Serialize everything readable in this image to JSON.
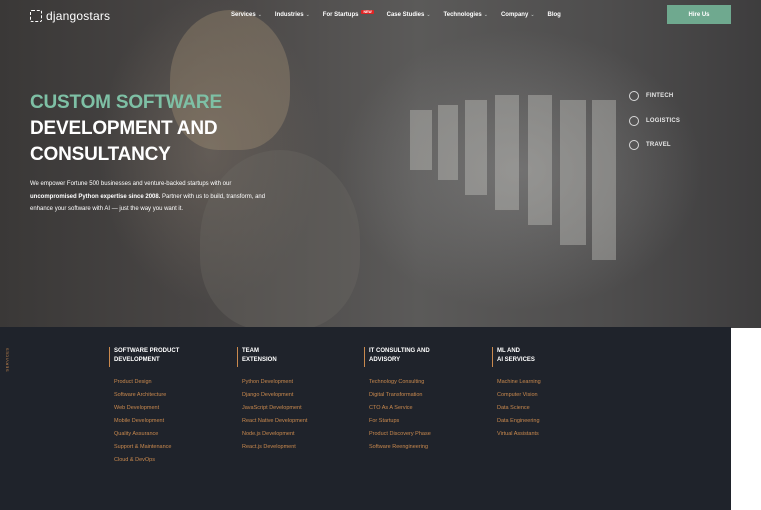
{
  "header": {
    "logo_text": "djangostars",
    "nav": [
      {
        "label": "Services",
        "has_chevron": true,
        "badge": ""
      },
      {
        "label": "Industries",
        "has_chevron": true,
        "badge": ""
      },
      {
        "label": "For Startups",
        "has_chevron": false,
        "badge": "NEW"
      },
      {
        "label": "Case Studies",
        "has_chevron": true,
        "badge": ""
      },
      {
        "label": "Technologies",
        "has_chevron": true,
        "badge": ""
      },
      {
        "label": "Company",
        "has_chevron": true,
        "badge": ""
      },
      {
        "label": "Blog",
        "has_chevron": false,
        "badge": ""
      }
    ],
    "cta_label": "Hire Us"
  },
  "hero": {
    "title_line1": "CUSTOM SOFTWARE",
    "title_line2": "DEVELOPMENT AND",
    "title_line3": "CONSULTANCY",
    "desc_part1": "We empower Fortune 500 businesses and venture-backed startups with our ",
    "desc_bold": "uncompromised Python expertise since 2008.",
    "desc_part2": " Partner with us to build, transform, and enhance your software with AI — just the way you want it.",
    "industries": [
      "FINTECH",
      "LOGISTICS",
      "TRAVEL"
    ]
  },
  "services": {
    "vertical_label": "SERVICES",
    "columns": [
      {
        "heading_line1": "SOFTWARE PRODUCT",
        "heading_line2": "DEVELOPMENT",
        "items": [
          "Product Design",
          "Software Architecture",
          "Web Development",
          "Mobile Development",
          "Quality Assurance",
          "Support & Maintenance",
          "Cloud & DevOps"
        ]
      },
      {
        "heading_line1": "TEAM",
        "heading_line2": "EXTENSION",
        "items": [
          "Python Development",
          "Django Development",
          "JavaScript Development",
          "React Native Development",
          "Node.js Development",
          "React.js Development"
        ]
      },
      {
        "heading_line1": "IT CONSULTING AND",
        "heading_line2": "ADVISORY",
        "items": [
          "Technology Consulting",
          "Digital Transformation",
          "CTO As A Service",
          "For Startups",
          "Product Discovery Phase",
          "Software Reengineering"
        ]
      },
      {
        "heading_line1": "ML AND",
        "heading_line2": "AI SERVICES",
        "items": [
          "Machine Learning",
          "Computer Vision",
          "Data Science",
          "Data Engineering",
          "Virtual Assistants"
        ]
      }
    ]
  },
  "colors": {
    "accent_green": "#7ec0a5",
    "button_green": "#6fa98f",
    "link_orange": "#c9894e",
    "panel_dark": "#1f232b"
  }
}
